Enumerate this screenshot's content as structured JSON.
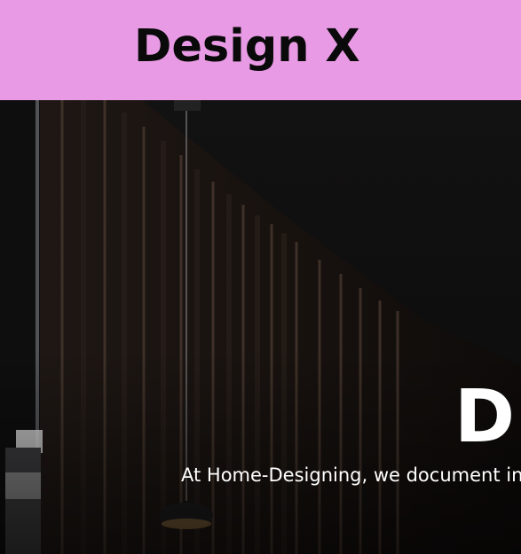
{
  "header": {
    "brand": "Design X",
    "background": "#e89be4"
  },
  "hero": {
    "heading": "DE",
    "text": "At Home-Designing, we document interior",
    "image": "dark-interior-wooden-slat-wall-with-pendant-lamp"
  }
}
